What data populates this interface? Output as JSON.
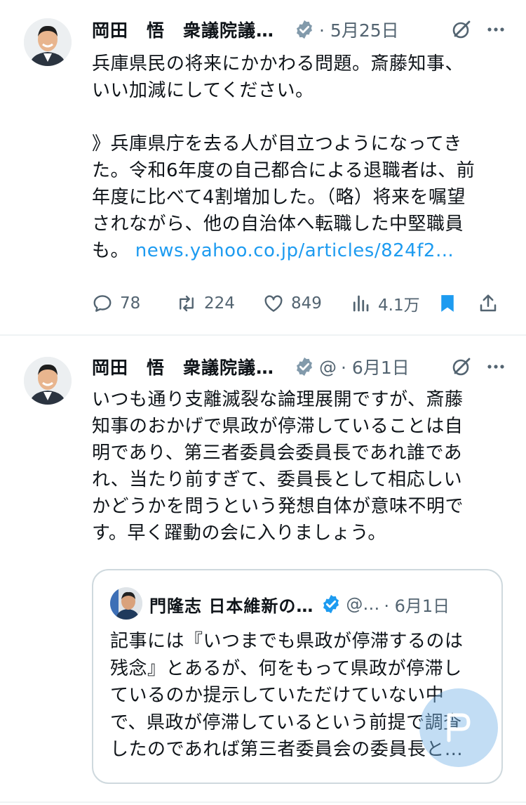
{
  "colors": {
    "accent": "#1d9bf0",
    "muted": "#536471",
    "text": "#0f1419",
    "border": "#cfd9de"
  },
  "tweets": [
    {
      "author": "岡田　悟　衆議院議…",
      "handle": "",
      "date": "· 5月25日",
      "text": "兵庫県民の将来にかかわる問題。斎藤知事、\nいい加減にしてください。\n\n》兵庫県庁を去る人が目立つようになってき\nた。令和6年度の自己都合による退職者は、前\n年度に比べて4割増加した。（略）将来を嘱望\nされながら、他の自治体へ転職した中堅職員\nも。 ",
      "link": "news.yahoo.co.jp/articles/824f2…",
      "metrics": {
        "replies": "78",
        "retweets": "224",
        "likes": "849",
        "views": "4.1万"
      },
      "icons": [
        "verified-icon",
        "grok-icon",
        "more-icon",
        "reply-icon",
        "retweet-icon",
        "like-icon",
        "views-icon",
        "bookmark-icon",
        "share-icon"
      ]
    },
    {
      "author": "岡田　悟　衆議院議…",
      "handle": "@",
      "date": "· 6月1日",
      "text": "いつも通り支離滅裂な論理展開ですが、斎藤\n知事のおかげで県政が停滞していることは自\n明であり、第三者委員会委員長であれ誰であ\nれ、当たり前すぎて、委員長として相応しい\nかどうかを問うという発想自体が意味不明で\nす。早く躍動の会に入りましょう。",
      "quote": {
        "author": "門隆志 日本維新の…",
        "handle": "@…",
        "date": "· 6月1日",
        "text": "記事には『いつまでも県政が停滞するのは\n残念』とあるが、何をもって県政が停滞し\nているのか提示していただけていない中\nで、県政が停滞しているという前提で調査\nしたのであれば第三者委員会の委員長と…"
      }
    }
  ]
}
